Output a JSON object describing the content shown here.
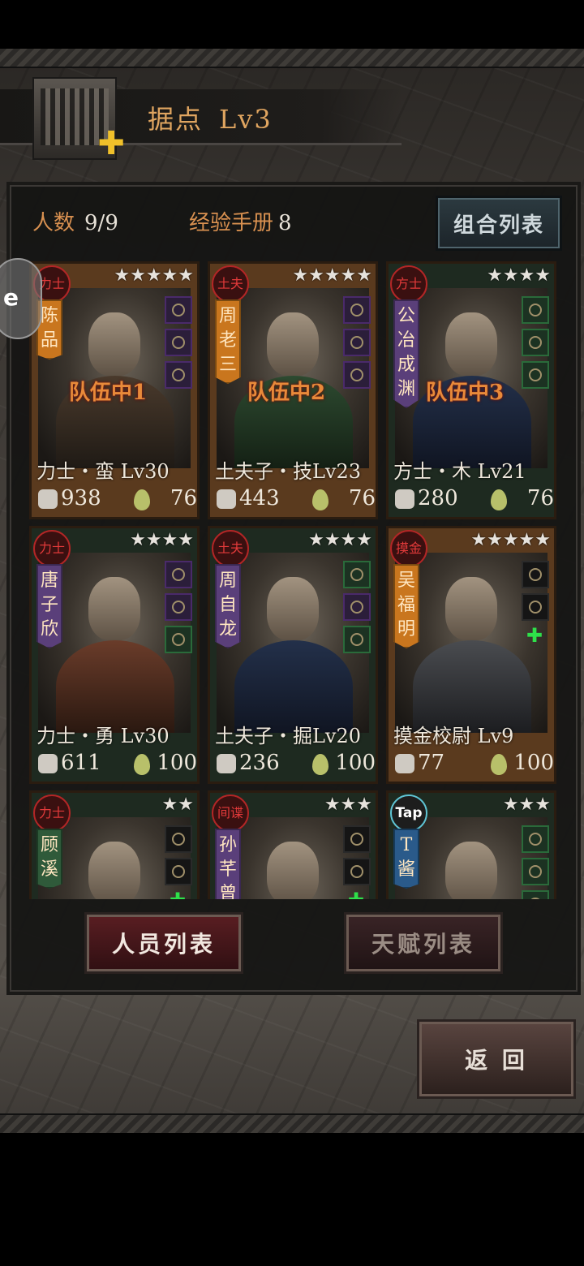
{
  "header": {
    "title": "据点",
    "level": "Lv3"
  },
  "summary": {
    "people_label": "人数",
    "people_value": "9/9",
    "exp_label": "经验手册",
    "exp_value": "8"
  },
  "combo_button": "组合列表",
  "side_tab": "e",
  "characters": [
    {
      "seal": "力士",
      "stars": "★★★★★",
      "name": "陈品",
      "team": "队伍中1",
      "class": "力士・蛮 Lv30",
      "power": "938",
      "hp": "76"
    },
    {
      "seal": "土夫",
      "stars": "★★★★★",
      "name": "周老三",
      "team": "队伍中2",
      "class": "土夫子・技Lv23",
      "power": "443",
      "hp": "76"
    },
    {
      "seal": "方士",
      "stars": "★★★★",
      "name": "公冶成渊",
      "team": "队伍中3",
      "class": "方士・木 Lv21",
      "power": "280",
      "hp": "76"
    },
    {
      "seal": "力士",
      "stars": "★★★★",
      "name": "唐子欣",
      "team": "",
      "class": "力士・勇 Lv30",
      "power": "611",
      "hp": "100"
    },
    {
      "seal": "土夫",
      "stars": "★★★★",
      "name": "周自龙",
      "team": "",
      "class": "土夫子・掘Lv20",
      "power": "236",
      "hp": "100"
    },
    {
      "seal": "摸金",
      "stars": "★★★★★",
      "name": "吴福明",
      "team": "",
      "class": "摸金校尉 Lv9",
      "power": "77",
      "hp": "100"
    },
    {
      "seal": "力士",
      "stars": "★★",
      "name": "顾溪",
      "team": "",
      "class": "",
      "power": "",
      "hp": ""
    },
    {
      "seal": "间谍",
      "stars": "★★★",
      "name": "孙芊曾",
      "team": "",
      "class": "",
      "power": "",
      "hp": ""
    },
    {
      "seal": "Tap",
      "stars": "★★★",
      "name": "T酱",
      "team": "",
      "class": "",
      "power": "",
      "hp": ""
    }
  ],
  "buttons": {
    "personnel": "人员列表",
    "talent": "天赋列表",
    "back": "返 回"
  },
  "colors": {
    "accent": "#d89050",
    "team_tag": "#e88a3a",
    "seal_red": "#b32626",
    "active_tab": "#5a1e22"
  }
}
